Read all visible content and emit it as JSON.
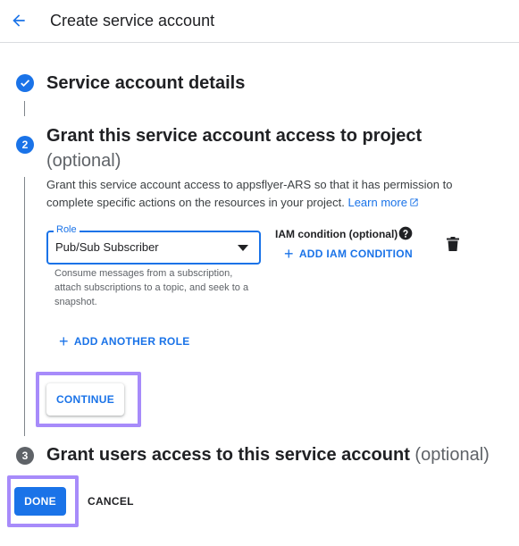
{
  "header": {
    "title": "Create service account",
    "back_icon": "arrow-back-icon"
  },
  "steps": [
    {
      "number": "",
      "title": "Service account details",
      "optional": "",
      "state": "completed"
    },
    {
      "number": "2",
      "title": "Grant this service account access to project",
      "optional": "(optional)",
      "state": "active"
    },
    {
      "number": "3",
      "title": "Grant users access to this service account",
      "optional": "(optional)",
      "state": "inactive"
    }
  ],
  "grant": {
    "description": "Grant this service account access to appsflyer-ARS so that it has permission to complete specific actions on the resources in your project.",
    "learn_more": "Learn more",
    "role_label": "Role",
    "role_value": "Pub/Sub Subscriber",
    "role_help": "Consume messages from a subscription, attach subscriptions to a topic, and seek to a snapshot.",
    "iam_condition_label": "IAM condition (optional)",
    "add_iam_condition": "ADD IAM CONDITION",
    "add_another_role": "ADD ANOTHER ROLE",
    "continue": "CONTINUE"
  },
  "footer": {
    "done": "DONE",
    "cancel": "CANCEL"
  },
  "colors": {
    "accent": "#1a73e8",
    "highlight": "#a78bfa",
    "inactive_step": "#5f6368"
  }
}
